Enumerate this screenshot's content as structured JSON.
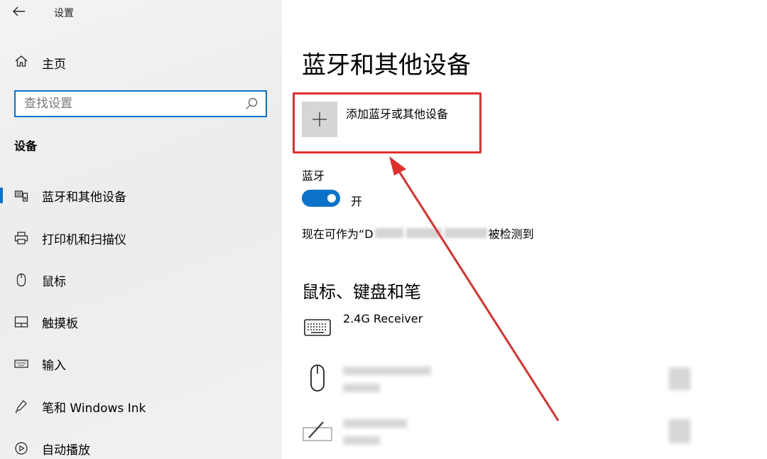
{
  "window": {
    "title": "设置"
  },
  "sidebar": {
    "home_label": "主页",
    "search": {
      "placeholder": "查找设置"
    },
    "section_heading": "设备",
    "items": [
      {
        "label": "蓝牙和其他设备",
        "icon": "bluetooth-devices-icon",
        "selected": true
      },
      {
        "label": "打印机和扫描仪",
        "icon": "printer-icon"
      },
      {
        "label": "鼠标",
        "icon": "mouse-icon"
      },
      {
        "label": "触摸板",
        "icon": "touchpad-icon"
      },
      {
        "label": "输入",
        "icon": "keyboard-icon"
      },
      {
        "label": "笔和 Windows Ink",
        "icon": "pen-icon"
      },
      {
        "label": "自动播放",
        "icon": "autoplay-icon"
      }
    ]
  },
  "main": {
    "title": "蓝牙和其他设备",
    "add_device_label": "添加蓝牙或其他设备",
    "bluetooth_label": "蓝牙",
    "bluetooth_state": "开",
    "discoverable_prefix": "现在可作为“D",
    "discoverable_suffix": "被检测到",
    "section_heading": "鼠标、键盘和笔",
    "devices": [
      {
        "name": "2.4G Receiver",
        "icon": "keyboard-icon"
      }
    ]
  },
  "colors": {
    "accent": "#0a72c9",
    "annotation": "#e0302b"
  }
}
